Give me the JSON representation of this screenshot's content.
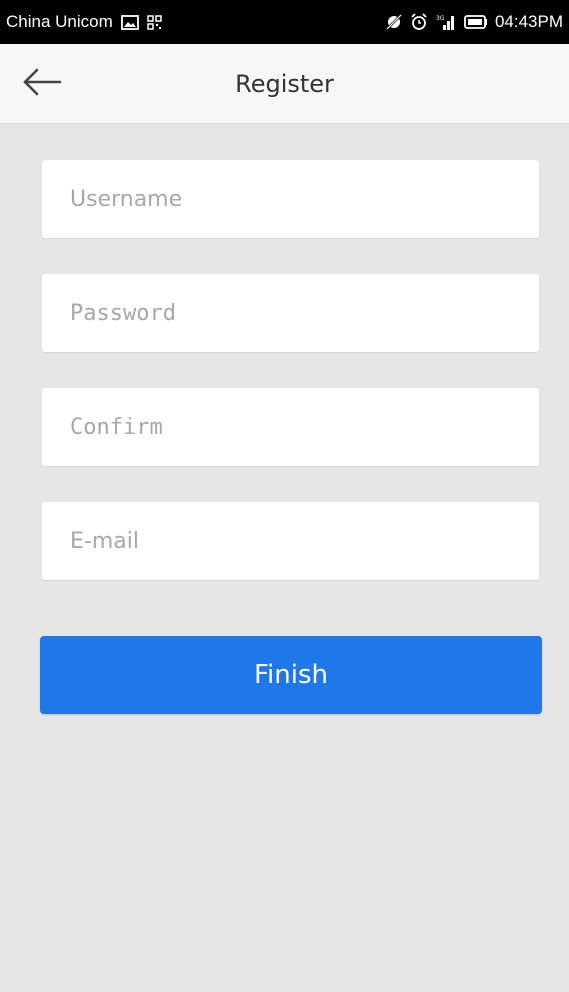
{
  "status_bar": {
    "carrier": "China Unicom",
    "time": "04:43PM",
    "left_icons": [
      "image-icon",
      "qr-icon"
    ],
    "right_icons": [
      "no-sync-icon",
      "alarm-icon",
      "signal-icon",
      "battery-icon"
    ]
  },
  "header": {
    "title": "Register",
    "back_icon": "arrow-left-icon"
  },
  "form": {
    "username": {
      "placeholder": "Username",
      "value": ""
    },
    "password": {
      "placeholder": "Password",
      "value": ""
    },
    "confirm": {
      "placeholder": "Confirm",
      "value": ""
    },
    "email": {
      "placeholder": "E-mail",
      "value": ""
    },
    "finish_label": "Finish"
  },
  "colors": {
    "primary": "#1e78e8",
    "background": "#e6e6e6",
    "title_bar": "#f7f7f7",
    "status_bar": "#000000"
  }
}
